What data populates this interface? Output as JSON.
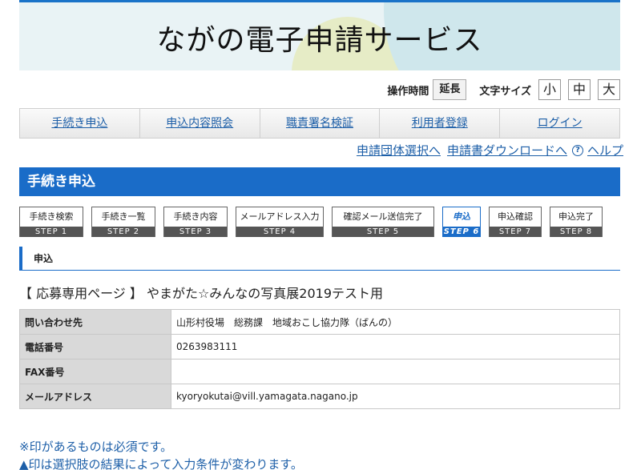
{
  "header": {
    "title": "ながの電子申請サービス"
  },
  "toolbar": {
    "time_label": "操作時間",
    "extend_button": "延長",
    "font_size_label": "文字サイズ",
    "size_small": "小",
    "size_medium": "中",
    "size_large": "大"
  },
  "nav": {
    "items": [
      "手続き申込",
      "申込内容照会",
      "職責署名検証",
      "利用者登録",
      "ログイン"
    ]
  },
  "sublinks": {
    "group_select": "申請団体選択へ",
    "download": "申請書ダウンロードへ",
    "help": "ヘルプ"
  },
  "section": {
    "title": "手続き申込"
  },
  "steps": [
    {
      "name": "手続き検索",
      "no": "STEP 1"
    },
    {
      "name": "手続き一覧",
      "no": "STEP 2"
    },
    {
      "name": "手続き内容",
      "no": "STEP 3"
    },
    {
      "name": "メールアドレス入力",
      "no": "STEP 4"
    },
    {
      "name": "確認メール送信完了",
      "no": "STEP 5"
    },
    {
      "name": "申込",
      "no": "STEP 6"
    },
    {
      "name": "申込確認",
      "no": "STEP 7"
    },
    {
      "name": "申込完了",
      "no": "STEP 8"
    }
  ],
  "active_step": 6,
  "subheading": "申込",
  "page_title": "【 応募専用ページ 】 やまがた☆みんなの写真展2019テスト用",
  "contact": [
    {
      "label": "問い合わせ先",
      "value": "山形村役場　総務課　地域おこし協力隊（ばんの）"
    },
    {
      "label": "電話番号",
      "value": "0263983111"
    },
    {
      "label": "FAX番号",
      "value": ""
    },
    {
      "label": "メールアドレス",
      "value": "kyoryokutai@vill.yamagata.nagano.jp"
    }
  ],
  "notes": {
    "required": "※印があるものは必須です。",
    "conditional": "▲印は選択肢の結果によって入力条件が変わります。"
  },
  "colors": {
    "accent": "#1a6cc8",
    "link": "#1d5fa8"
  }
}
